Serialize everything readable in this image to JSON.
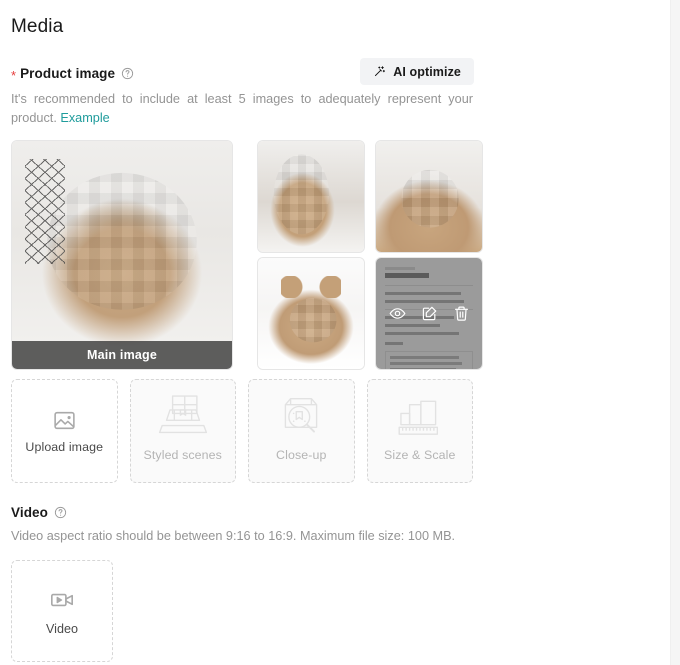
{
  "page": {
    "title": "Media"
  },
  "product_image": {
    "required_marker": "*",
    "label": "Product image",
    "help_icon": "question-circle-icon",
    "ai_button": {
      "label": "AI optimize",
      "icon": "magic-wand-icon"
    },
    "description_before": "It's recommended to include at least 5 images to adequately represent your product.",
    "example_link": "Example",
    "main_badge": "Main image",
    "thumbnails": [
      {
        "name": "main-product-photo",
        "badge": "Main image"
      },
      {
        "name": "product-photo-2",
        "badge": ""
      },
      {
        "name": "product-photo-3",
        "badge": ""
      },
      {
        "name": "product-photo-4",
        "badge": ""
      },
      {
        "name": "product-spec-sheet",
        "badge": ""
      }
    ],
    "hover_actions": [
      {
        "name": "preview-icon",
        "title": "Preview"
      },
      {
        "name": "edit-icon",
        "title": "Edit"
      },
      {
        "name": "delete-icon",
        "title": "Delete"
      }
    ],
    "placeholders": [
      {
        "label": "Upload image",
        "icon": "image-placeholder-icon",
        "disabled": false
      },
      {
        "label": "Styled scenes",
        "icon": "styled-scenes-icon",
        "disabled": true
      },
      {
        "label": "Close-up",
        "icon": "close-up-icon",
        "disabled": true
      },
      {
        "label": "Size & Scale",
        "icon": "size-scale-icon",
        "disabled": true
      }
    ]
  },
  "video": {
    "label": "Video",
    "help_icon": "question-circle-icon",
    "description": "Video aspect ratio should be between 9:16 to 16:9. Maximum file size: 100 MB.",
    "upload_card": {
      "label": "Video",
      "icon": "video-camera-icon"
    }
  },
  "colors": {
    "required_red": "#e63c3c",
    "link_teal": "#1f9c9c",
    "muted_text": "#949494",
    "button_bg": "#f2f3f5"
  }
}
